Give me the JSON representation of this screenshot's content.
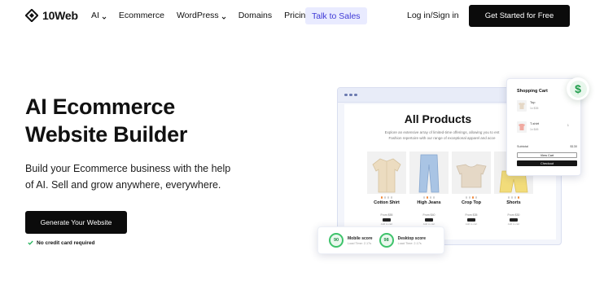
{
  "header": {
    "brand": "10Web",
    "nav": [
      {
        "label": "AI",
        "has_dropdown": true
      },
      {
        "label": "Ecommerce",
        "has_dropdown": false
      },
      {
        "label": "WordPress",
        "has_dropdown": true
      },
      {
        "label": "Domains",
        "has_dropdown": false
      },
      {
        "label": "Pricing",
        "has_dropdown": false
      }
    ],
    "talk_to_sales": "Talk to Sales",
    "login": "Log in/Sign in",
    "get_started": "Get Started for Free"
  },
  "hero": {
    "title_line1": "AI Ecommerce",
    "title_line2": "Website Builder",
    "subtitle_line1": "Build your Ecommerce business with the help",
    "subtitle_line2": "of AI. Sell and grow anywhere, everywhere.",
    "cta": "Generate Your Website",
    "no_card": "No credit card required"
  },
  "mockup": {
    "heading": "All Products",
    "description_line1": "Explore an extensive array of limited-time offerings, allowing you to ent",
    "description_line2": "Fashion repertoire with our range of exceptional apparel and acce",
    "products": [
      {
        "name": "Cotton Shirt",
        "price": "From $55",
        "meta": "Add to cart",
        "color": "#ecdcc0"
      },
      {
        "name": "High Jeans",
        "price": "From $40",
        "meta": "Add to cart",
        "color": "#a9c4e4"
      },
      {
        "name": "Crop Top",
        "price": "From $35",
        "meta": "Add to cart",
        "color": "#e5d8c6"
      },
      {
        "name": "Shorts",
        "price": "From $30",
        "meta": "Add to cart",
        "color": "#f2dc7a"
      }
    ],
    "cart": {
      "title": "Shopping Cart",
      "items": [
        {
          "name": "Top",
          "price": "1x $35",
          "qty": ""
        },
        {
          "name": "T-shirt",
          "price": "1x $45",
          "qty": "1"
        }
      ],
      "subtotal_label": "Subtotal",
      "subtotal_value": "$130",
      "view_cart": "View Cart",
      "checkout": "Checkout"
    },
    "badge_symbol": "$",
    "scores": [
      {
        "value": "90",
        "label": "Mobile score",
        "load": "Load Time: 2.17s"
      },
      {
        "value": "98",
        "label": "Desktop score",
        "load": "Load Time: 2.17s"
      }
    ]
  },
  "colors": {
    "accent": "#3f3ad6",
    "accent_bg": "#e9ebff",
    "dark": "#0b0b0b",
    "success": "#24b35b"
  }
}
